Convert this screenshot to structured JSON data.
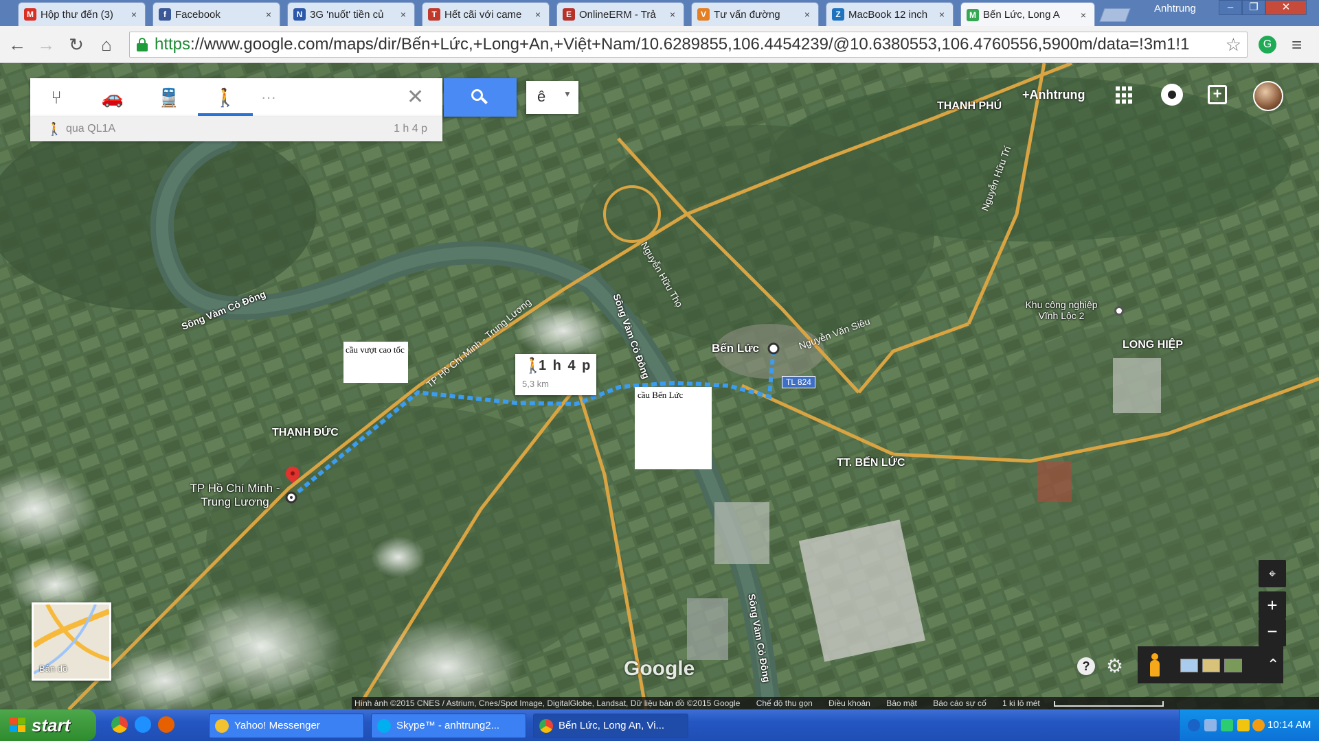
{
  "browser": {
    "tabs": [
      {
        "label": "Hộp thư đến (3)",
        "favicon": "gmail-icon",
        "color": "#d93025",
        "glyph": "M"
      },
      {
        "label": "Facebook",
        "favicon": "facebook-icon",
        "color": "#3b5998",
        "glyph": "f"
      },
      {
        "label": "3G 'nuốt' tiền củ",
        "favicon": "news-icon",
        "color": "#2b58a8",
        "glyph": "N"
      },
      {
        "label": "Hết cãi với came",
        "favicon": "news-icon",
        "color": "#c0392b",
        "glyph": "T"
      },
      {
        "label": "OnlineERM - Trả",
        "favicon": "erm-icon",
        "color": "#b5322b",
        "glyph": "E"
      },
      {
        "label": "Tư vấn đường",
        "favicon": "forum-icon",
        "color": "#e67e22",
        "glyph": "V"
      },
      {
        "label": "MacBook 12 inch",
        "favicon": "zing-icon",
        "color": "#1e73be",
        "glyph": "Z"
      },
      {
        "label": "Bến Lức, Long A",
        "favicon": "maps-icon",
        "color": "#34a853",
        "glyph": "M"
      }
    ],
    "tab_close_glyph": "×",
    "profile_name": "Anhtrung",
    "window_buttons": {
      "minimize": "–",
      "restore": "❐",
      "close": "✕"
    },
    "nav": {
      "back": "←",
      "forward": "→",
      "reload": "↻",
      "home": "⌂"
    },
    "url_scheme": "https",
    "url_rest": "://www.google.com/maps/dir/Bến+Lức,+Long+An,+Việt+Nam/10.6289855,106.4454239/@10.6380553,106.4760556,5900m/data=!3m1!1",
    "star_glyph": "☆",
    "menu_glyph": "≡",
    "ext_glyph": "G"
  },
  "directions": {
    "modes": [
      {
        "name": "directions-mode-icon",
        "glyph": "⑂"
      },
      {
        "name": "car-icon",
        "glyph": "🚗"
      },
      {
        "name": "transit-icon",
        "glyph": "🚆"
      },
      {
        "name": "walk-icon",
        "glyph": "🚶"
      }
    ],
    "more": "···",
    "close_glyph": "✕",
    "route_walk_glyph": "🚶",
    "route_via": "qua QL1A",
    "route_time": "1 h 4 p",
    "language_label": "ê",
    "language_caret": "▼"
  },
  "gbar": {
    "user": "+Anhtrung",
    "share_glyph": "+"
  },
  "map": {
    "labels": {
      "song_vam_co_dong": "Sông Vàm Cỏ Đông",
      "song_vam_co_dong_2": "Sông Vàm Cỏ Đông",
      "song_vam_co_dong_3": "Sông Vàm Cỏ Đông",
      "thanh_duc": "THẠNH ĐỨC",
      "ben_luc": "Bến Lức",
      "tt_ben_luc": "TT. BẾN LỨC",
      "long_hiep": "LONG HIỆP",
      "thanh_phu": "THANH PHÚ",
      "kcn": "Khu công nghiệp Vĩnh Lộc 2",
      "start_place": "TP Hồ Chí Minh - Trung Lương",
      "road_tphcm": "TP Hồ Chí Minh - Trung Lương",
      "road_nht": "Nguyễn Hữu Thọ",
      "road_nht2": "Nguyễn Hữu Trí",
      "road_nvs": "Nguyễn Văn Siêu",
      "tl824": "TL 824"
    },
    "walk_callout": {
      "glyph": "🚶",
      "time": "1 h 4 p",
      "distance": "5,3 km"
    },
    "note_overpass": "cầu vượt cao tốc",
    "note_bridge": "cầu Bến Lức",
    "minimap_label": "Bản đồ",
    "controls": {
      "locate": "⌖",
      "zoom_in": "+",
      "zoom_out": "−",
      "help": "?",
      "settings": "⚙",
      "expand": "⌃"
    },
    "logo": "Google",
    "attribution": {
      "imagery": "Hình ảnh ©2015 CNES / Astrium, Cnes/Spot Image, DigitalGlobe, Landsat, Dữ liệu bản đồ ©2015 Google",
      "lite_mode": "Chế độ thu gọn",
      "terms": "Điều khoản",
      "privacy": "Bảo mật",
      "report": "Báo cáo sự cố",
      "scale": "1 ki lô mét"
    },
    "colors": {
      "route": "#3b9cf0",
      "highway": "#d9a441",
      "river": "#4c6b5c"
    }
  },
  "taskbar": {
    "start_label": "start",
    "tasks": [
      {
        "label": "Yahoo! Messenger",
        "icon_color": "#f2c230"
      },
      {
        "label": "Skype™ - anhtrung2...",
        "icon_color": "#00aff0"
      },
      {
        "label": "Bến Lức, Long An, Vi...",
        "icon_color": "#34a853"
      }
    ],
    "clock": "10:14 AM"
  }
}
